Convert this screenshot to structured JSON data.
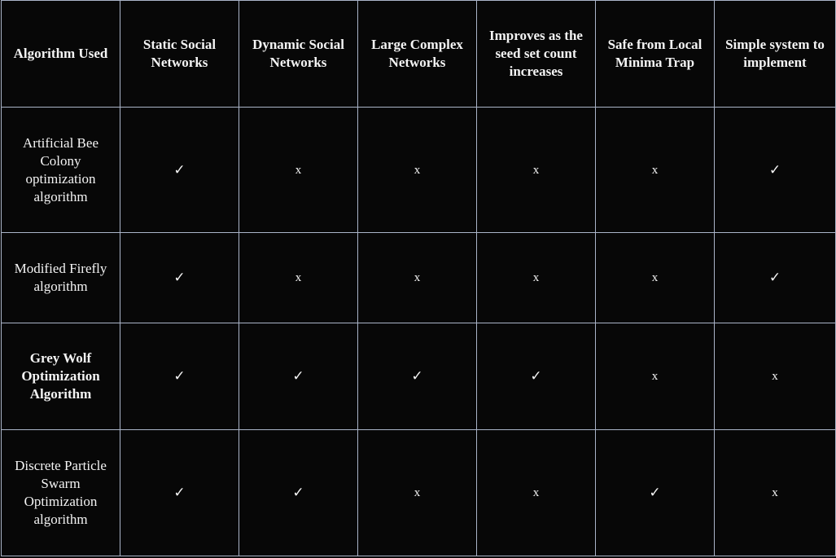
{
  "table": {
    "headers": [
      "Algorithm Used",
      "Static Social Networks",
      "Dynamic Social Networks",
      "Large Complex Networks",
      "Improves as the seed set count increases",
      "Safe from Local Minima Trap",
      "Simple system to implement"
    ],
    "rows": [
      {
        "name": "Artificial Bee Colony optimization algorithm",
        "bold": false,
        "marks": [
          "✓",
          "x",
          "x",
          "x",
          "x",
          "✓"
        ]
      },
      {
        "name": "Modified Firefly algorithm",
        "bold": false,
        "marks": [
          "✓",
          "x",
          "x",
          "x",
          "x",
          "✓"
        ]
      },
      {
        "name": "Grey Wolf Optimization Algorithm",
        "bold": true,
        "marks": [
          "✓",
          "✓",
          "✓",
          "✓",
          "x",
          "x"
        ]
      },
      {
        "name": "Discrete Particle Swarm Optimization algorithm",
        "bold": false,
        "marks": [
          "✓",
          "✓",
          "x",
          "x",
          "✓",
          "x"
        ]
      }
    ]
  },
  "colors": {
    "background": "#070707",
    "grid": "#aab4c8",
    "text": "#f4f4f4"
  }
}
